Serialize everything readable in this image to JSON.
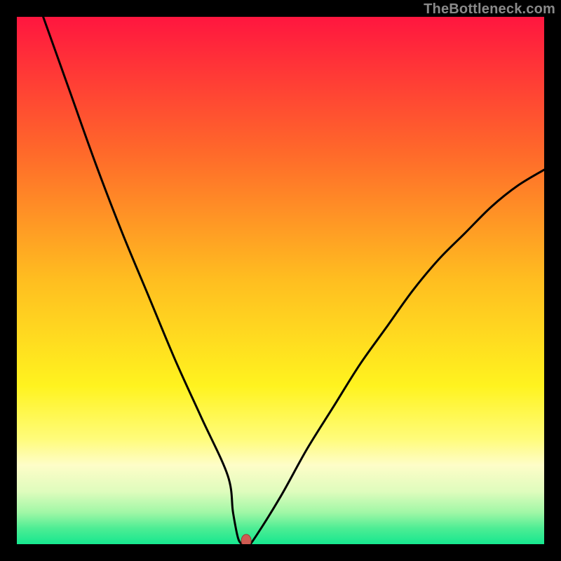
{
  "watermark": "TheBottleneck.com",
  "chart_data": {
    "type": "line",
    "title": "",
    "xlabel": "",
    "ylabel": "",
    "xlim": [
      0,
      100
    ],
    "ylim": [
      0,
      100
    ],
    "x": [
      5,
      10,
      15,
      20,
      25,
      30,
      35,
      40,
      41,
      42,
      43,
      44,
      45,
      50,
      55,
      60,
      65,
      70,
      75,
      80,
      85,
      90,
      95,
      100
    ],
    "y": [
      100,
      86,
      72,
      59,
      47,
      35,
      24,
      13,
      6,
      1,
      0,
      0,
      1,
      9,
      18,
      26,
      34,
      41,
      48,
      54,
      59,
      64,
      68,
      71
    ],
    "marker": {
      "x": 43.5,
      "y": 0
    },
    "gradient_stops": [
      {
        "offset": 0,
        "color": "#ff163f"
      },
      {
        "offset": 26,
        "color": "#ff6a2a"
      },
      {
        "offset": 50,
        "color": "#ffbe20"
      },
      {
        "offset": 70,
        "color": "#fff31f"
      },
      {
        "offset": 80,
        "color": "#fffc7a"
      },
      {
        "offset": 85,
        "color": "#fefdc8"
      },
      {
        "offset": 90,
        "color": "#dffcbd"
      },
      {
        "offset": 94,
        "color": "#a0f7a6"
      },
      {
        "offset": 97,
        "color": "#4ded94"
      },
      {
        "offset": 100,
        "color": "#16e78f"
      }
    ],
    "colors": {
      "curve": "#000000",
      "marker_fill": "#cf5b52",
      "marker_stroke": "#9b3c34"
    }
  }
}
